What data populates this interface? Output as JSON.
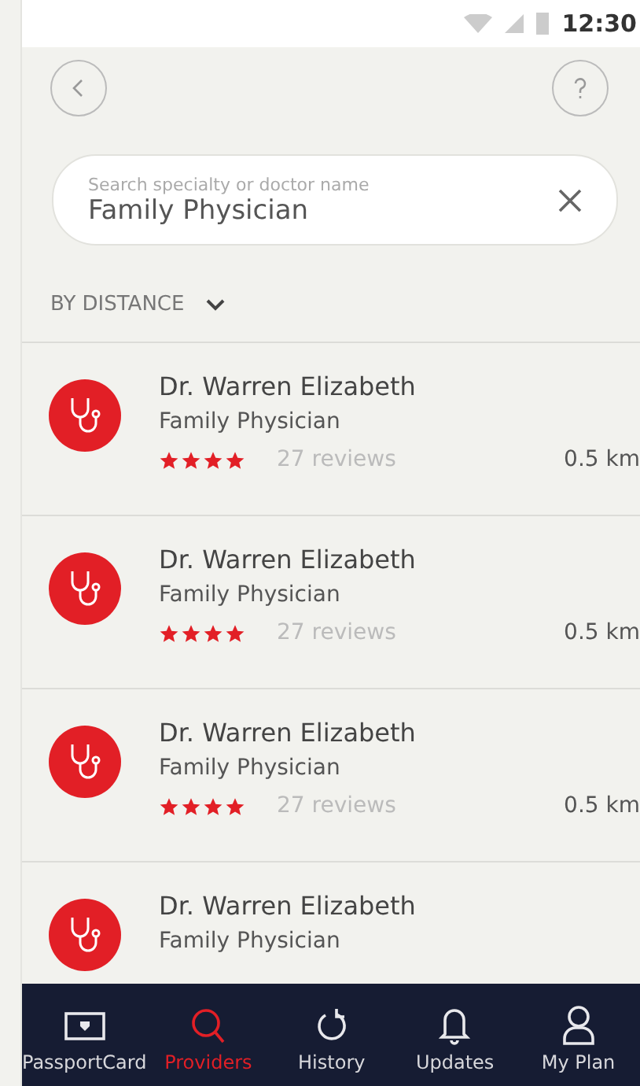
{
  "status_bar": {
    "time": "12:30"
  },
  "search": {
    "placeholder": "Search specialty or doctor name",
    "value": "Family Physician"
  },
  "sort": {
    "label": "BY DISTANCE"
  },
  "providers": [
    {
      "name": "Dr. Warren Elizabeth",
      "specialty": "Family Physician",
      "stars": 4,
      "reviews": "27 reviews",
      "distance": "0.5 km"
    },
    {
      "name": "Dr. Warren Elizabeth",
      "specialty": "Family Physician",
      "stars": 4,
      "reviews": "27 reviews",
      "distance": "0.5 km"
    },
    {
      "name": "Dr. Warren Elizabeth",
      "specialty": "Family Physician",
      "stars": 4,
      "reviews": "27 reviews",
      "distance": "0.5 km"
    },
    {
      "name": "Dr. Warren Elizabeth",
      "specialty": "Family Physician"
    }
  ],
  "nav": [
    {
      "label": "PassportCard",
      "selected": false
    },
    {
      "label": "Providers",
      "selected": true
    },
    {
      "label": "History",
      "selected": false
    },
    {
      "label": "Updates",
      "selected": false
    },
    {
      "label": "My Plan",
      "selected": false
    }
  ]
}
